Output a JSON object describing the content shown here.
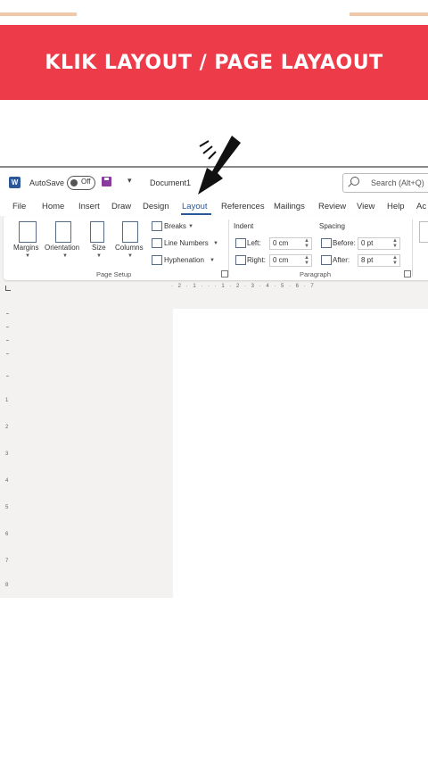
{
  "banner": {
    "title": "KLIK LAYOUT / PAGE LAYAOUT"
  },
  "titlebar": {
    "app_icon": "W",
    "autosave_label": "AutoSave",
    "autosave_state": "Off",
    "doc_title": "Document1",
    "search_placeholder": "Search (Alt+Q)"
  },
  "tabs": [
    "File",
    "Home",
    "Insert",
    "Draw",
    "Design",
    "Layout",
    "References",
    "Mailings",
    "Review",
    "View",
    "Help",
    "Ac"
  ],
  "active_tab": "Layout",
  "ribbon": {
    "page_setup": {
      "margins": "Margins",
      "orientation": "Orientation",
      "size": "Size",
      "columns": "Columns",
      "breaks": "Breaks",
      "line_numbers": "Line Numbers",
      "hyphenation": "Hyphenation",
      "group_label": "Page Setup"
    },
    "paragraph": {
      "indent_label": "Indent",
      "left_label": "Left:",
      "left_value": "0 cm",
      "right_label": "Right:",
      "right_value": "0 cm",
      "spacing_label": "Spacing",
      "before_label": "Before:",
      "before_value": "0 pt",
      "after_label": "After:",
      "after_value": "8 pt",
      "group_label": "Paragraph"
    }
  },
  "ruler": {
    "horizontal": "· 2 · 1 · · · 1 · 2 · 3 · 4 · 5 · 6 · 7",
    "vertical": [
      "1",
      "2",
      "3",
      "4",
      "5",
      "6",
      "7",
      "8"
    ]
  },
  "colors": {
    "banner": "#ed3b4a",
    "accent": "#2b579a",
    "background": "#f3f2f1"
  }
}
